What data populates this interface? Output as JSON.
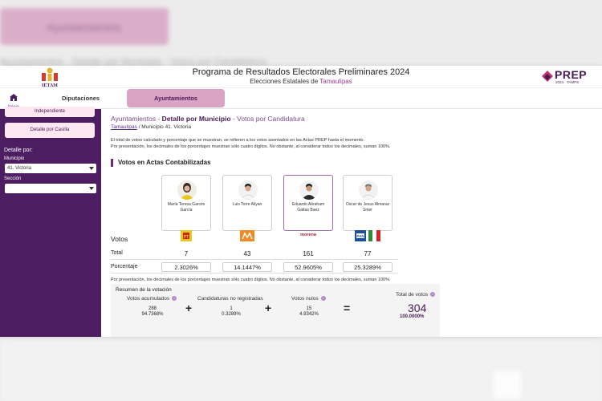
{
  "header": {
    "title": "Programa de Resultados Electorales Preliminares 2024",
    "subtitle_prefix": "Elecciones Estatales de ",
    "subtitle_state": "Tamaulipas",
    "left_logo_text": "IETAM",
    "prep_text": "PREP",
    "prep_sub": "2024 · TAMPS"
  },
  "nav": {
    "home_label": "Inicio",
    "tabs": [
      {
        "label": "Diputaciones"
      },
      {
        "label": "Ayuntamientos"
      }
    ]
  },
  "sidebar": {
    "button_top": "Independiente",
    "button_casilla": "Detalle por Casilla",
    "detalle_label": "Detalle por:",
    "municipio_label": "Municipio",
    "municipio_value": "41. Victoria",
    "seccion_label": "Sección",
    "seccion_value": ""
  },
  "breadcrumb": {
    "part1": "Ayuntamientos - ",
    "part2": "Detalle por Municipio",
    "part3": " - Votos por Candidatura",
    "link": "Tamaulipas",
    "rest": " / Municipio 41. Victoria"
  },
  "notes": {
    "line1": "El total de votos calculado y porcentaje que se muestran, se refieren a los votos asentados en las Actas PREP hasta el momento.",
    "line2": "Por presentación, los decimales de los porcentajes muestran sólo cuatro dígitos. No obstante, al considerar todos los decimales, suman 100%.",
    "line3": "Por presentación, los decimales de los porcentajes muestran sólo cuatro dígitos. No obstante, al considerar todos los decimales, suman 100%."
  },
  "section_title": "Votos en Actas Contabilizadas",
  "row_labels": {
    "votos": "Votos",
    "total": "Total",
    "porcentaje": "Porcentaje"
  },
  "candidates": [
    {
      "name": "María Teresa Garcés García",
      "party": "PT",
      "total": "7",
      "pct": "2.3026%"
    },
    {
      "name": "Luis Torre Aliyan",
      "party": "MC",
      "total": "43",
      "pct": "14.1447%"
    },
    {
      "name": "Eduardo Abraham Gattas Baez",
      "party": "morena",
      "total": "161",
      "pct": "52.9605%"
    },
    {
      "name": "Oscar de Jesus Almaraz Smer",
      "party": "PAN-PRI",
      "total": "77",
      "pct": "25.3289%"
    }
  ],
  "summary": {
    "title": "Resumen de la votación",
    "acumulados_label": "Votos acumulados",
    "acumulados_value": "288",
    "acumulados_pct": "94.7368%",
    "no_reg_label": "Candidaturas no registradas",
    "no_reg_value": "1",
    "no_reg_pct": "0.3289%",
    "nulos_label": "Votos nulos",
    "nulos_value": "15",
    "nulos_pct": "4.9342%",
    "total_label": "Total de votos",
    "total_value": "304",
    "total_pct": "100.0000%",
    "op_plus": "+",
    "op_eq": "="
  },
  "background": {
    "blur_title": "Ayuntamientos",
    "blur_text": "Ayuntamientos - Detalle por Municipio - Votos por Candidatura"
  },
  "colors": {
    "accent": "#4d1d61",
    "tab_active": "#d9a3c4",
    "highlight": "#9b3c8f"
  }
}
